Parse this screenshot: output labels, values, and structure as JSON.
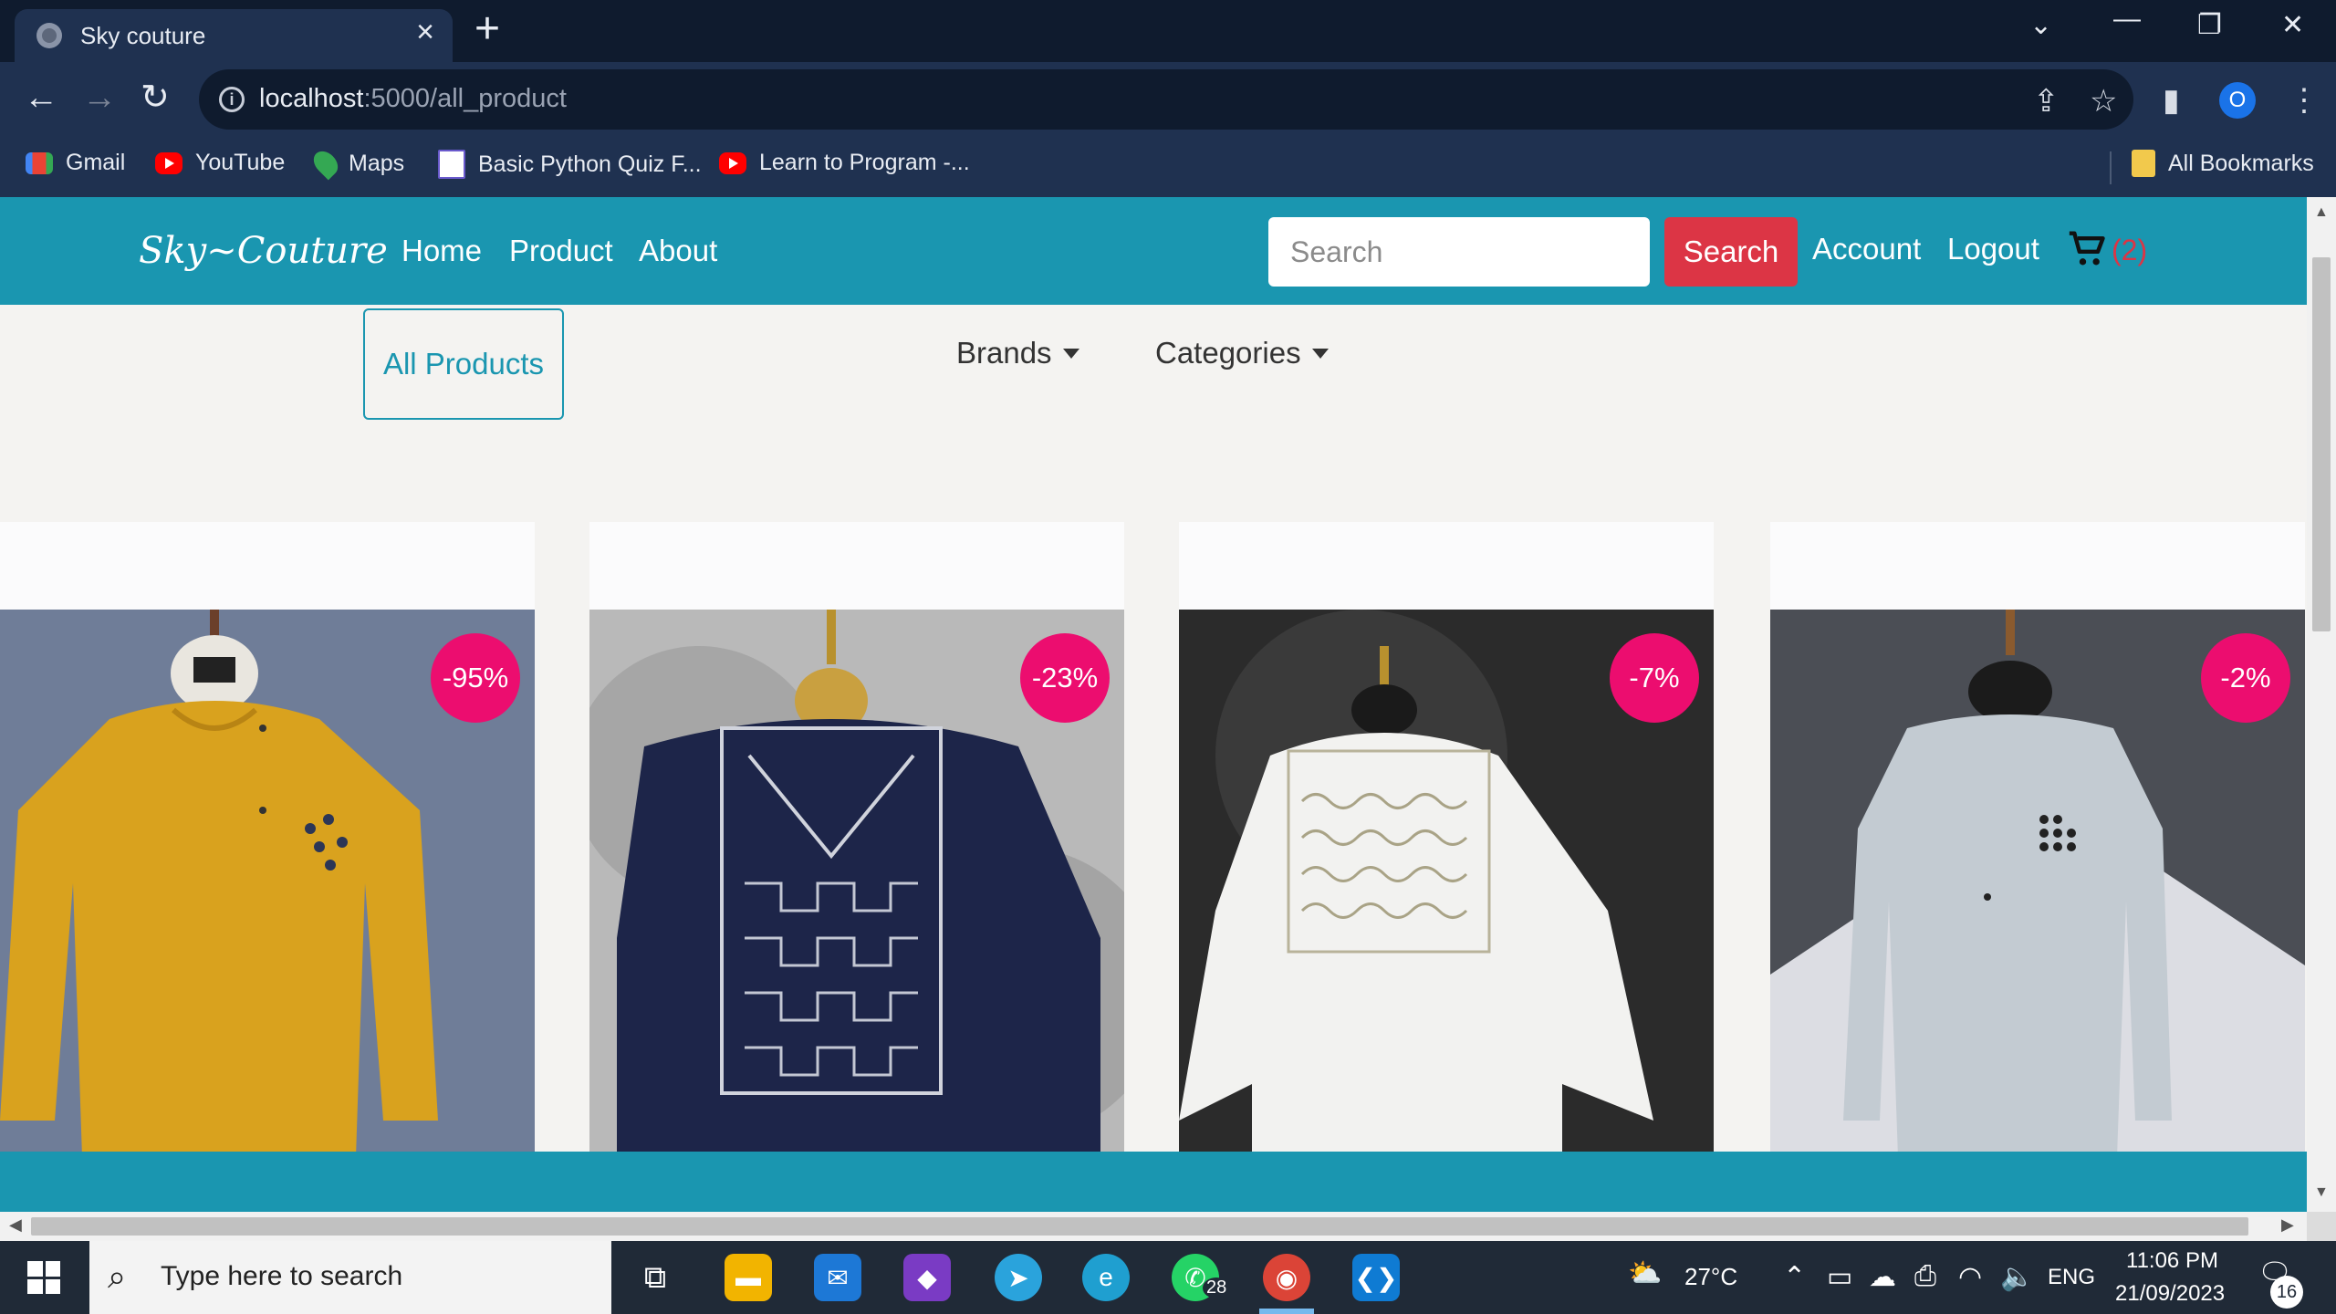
{
  "browser": {
    "tab_title": "Sky couture",
    "url_host": "localhost",
    "url_path": ":5000/all_product",
    "profile_initial": "O",
    "bookmarks": [
      {
        "label": "Gmail",
        "icon": "gmail-icon"
      },
      {
        "label": "YouTube",
        "icon": "youtube-icon"
      },
      {
        "label": "Maps",
        "icon": "maps-icon"
      },
      {
        "label": "Basic Python Quiz F...",
        "icon": "quiz-icon"
      },
      {
        "label": "Learn to Program -...",
        "icon": "youtube-icon"
      }
    ],
    "all_bookmarks_label": "All Bookmarks"
  },
  "site": {
    "brand": "Sky~Couture",
    "nav": [
      "Home",
      "Product",
      "About"
    ],
    "search_placeholder": "Search",
    "search_button": "Search",
    "account": "Account",
    "logout": "Logout",
    "cart_count": "(2)",
    "all_products": "All Products",
    "brands": "Brands",
    "categories": "Categories",
    "accent_color": "#1a96b0",
    "badge_color": "#ec0d6f"
  },
  "products": [
    {
      "discount": "-95%",
      "garment_color": "#d9a21e",
      "bg_color": "#6f7d98"
    },
    {
      "discount": "-23%",
      "garment_color": "#1d2549",
      "bg_color": "#b9b9b9"
    },
    {
      "discount": "-7%",
      "garment_color": "#f2f2f0",
      "bg_color": "#2b2b2b"
    },
    {
      "discount": "-2%",
      "garment_color": "#c3cbd2",
      "bg_color": "#4b4e55"
    }
  ],
  "taskbar": {
    "search_placeholder": "Type here to search",
    "weather": "27°C",
    "language": "ENG",
    "time": "11:06 PM",
    "date": "21/09/2023",
    "whatsapp_badge": "28",
    "notifications": "16"
  }
}
